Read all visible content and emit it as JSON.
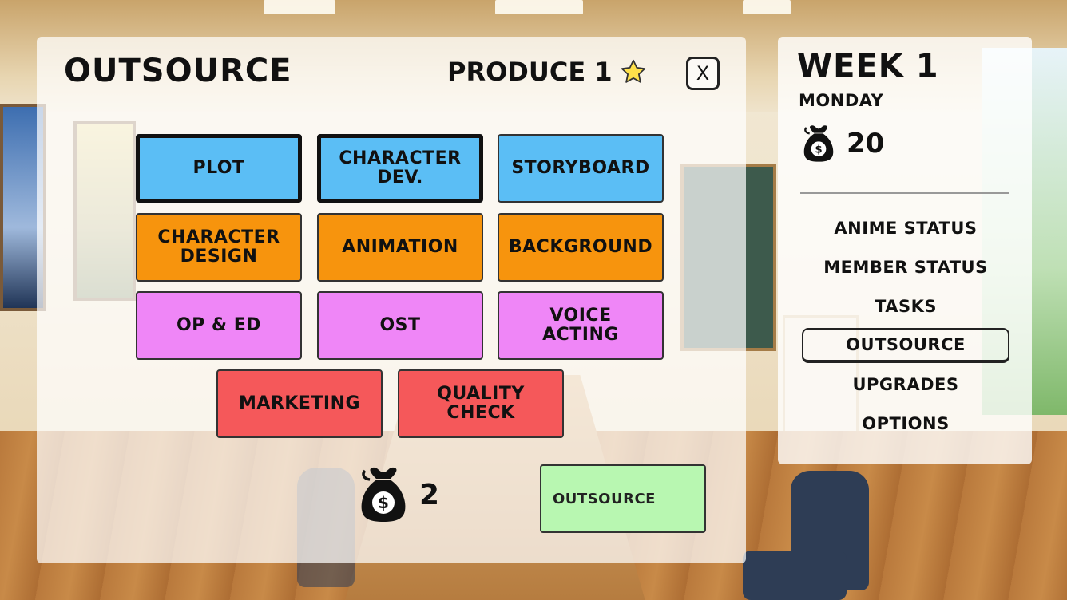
{
  "outsource_panel": {
    "title": "OUTSOURCE",
    "produce_label": "PRODUCE 1",
    "produce_icon": "star-icon",
    "close_label": "X",
    "tasks": [
      {
        "label": "PLOT",
        "color": "#5bbef5",
        "selected": true
      },
      {
        "label": "CHARACTER DEV.",
        "color": "#5bbef5",
        "selected": true
      },
      {
        "label": "STORYBOARD",
        "color": "#5bbef5",
        "selected": false
      },
      {
        "label": "CHARACTER DESIGN",
        "color": "#f7940d",
        "selected": false
      },
      {
        "label": "ANIMATION",
        "color": "#f7940d",
        "selected": false
      },
      {
        "label": "BACKGROUND",
        "color": "#f7940d",
        "selected": false
      },
      {
        "label": "OP & ED",
        "color": "#ef86f7",
        "selected": false
      },
      {
        "label": "OST",
        "color": "#ef86f7",
        "selected": false
      },
      {
        "label": "VOICE ACTING",
        "color": "#ef86f7",
        "selected": false
      },
      {
        "label": "MARKETING",
        "color": "#f5585a",
        "selected": false
      },
      {
        "label": "QUALITY CHECK",
        "color": "#f5585a",
        "selected": false
      }
    ],
    "cost_icon": "money-bag-icon",
    "cost": "2",
    "outsource_button": "OUTSOURCE",
    "outsource_button_color": "#b8f7b1"
  },
  "side_panel": {
    "week": "WEEK 1",
    "day": "MONDAY",
    "money_icon": "money-bag-icon",
    "money": "20",
    "menu": [
      {
        "label": "ANIME STATUS",
        "active": false
      },
      {
        "label": "MEMBER STATUS",
        "active": false
      },
      {
        "label": "TASKS",
        "active": false
      },
      {
        "label": "OUTSOURCE",
        "active": true
      },
      {
        "label": "UPGRADES",
        "active": false
      },
      {
        "label": "OPTIONS",
        "active": false
      }
    ]
  }
}
